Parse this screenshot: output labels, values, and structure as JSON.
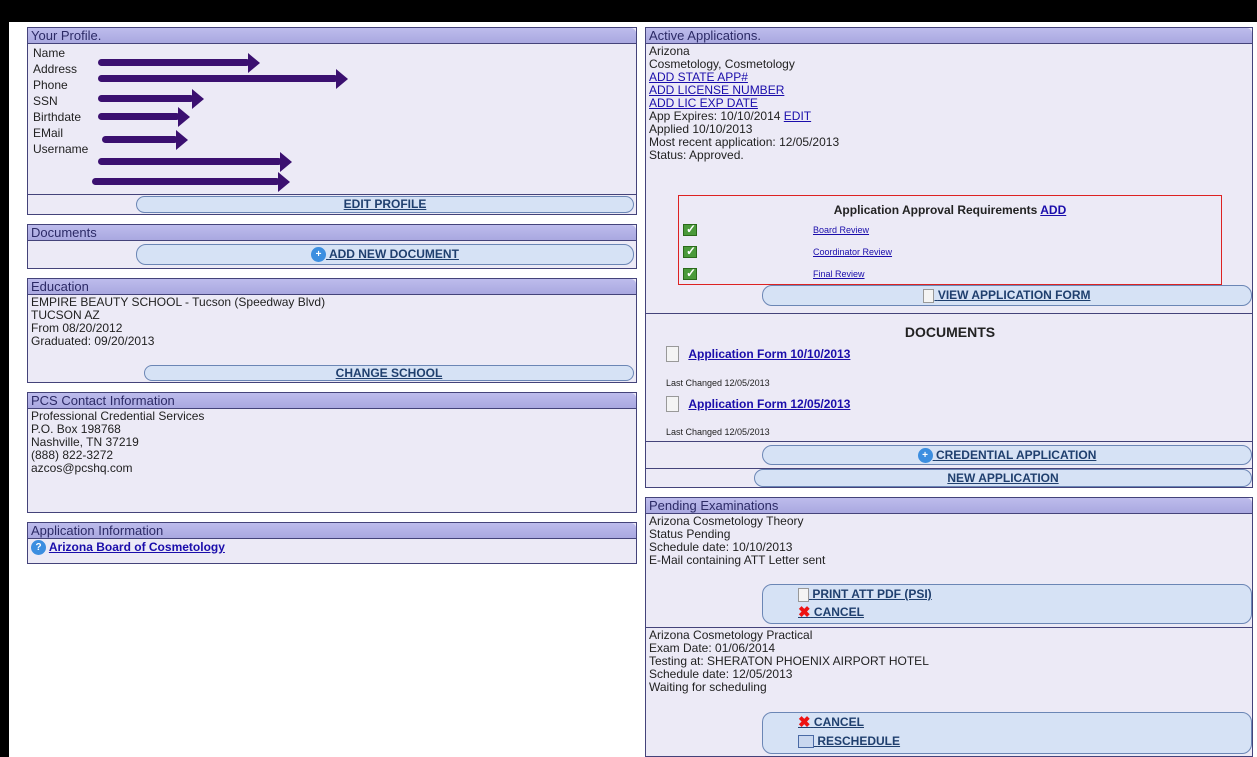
{
  "profile": {
    "title": "Your Profile.",
    "fields": [
      {
        "key": "Name"
      },
      {
        "key": "Address"
      },
      {
        "key": "Phone"
      },
      {
        "key": "SSN"
      },
      {
        "key": "Birthdate"
      },
      {
        "key": "EMail"
      },
      {
        "key": "Username"
      }
    ],
    "edit_label": "EDIT PROFILE"
  },
  "documents": {
    "title": "Documents",
    "add_label": "ADD NEW DOCUMENT"
  },
  "education": {
    "title": "Education",
    "school": "EMPIRE BEAUTY SCHOOL - Tucson (Speedway Blvd)",
    "city": "TUCSON AZ",
    "from": "From 08/20/2012",
    "graduated": "Graduated: 09/20/2013",
    "change_label": "CHANGE SCHOOL"
  },
  "contact": {
    "title": "PCS Contact Information",
    "lines": [
      "Professional Credential Services",
      "P.O. Box 198768",
      "Nashville, TN 37219",
      "(888) 822-3272",
      "azcos@pcshq.com"
    ]
  },
  "app_info": {
    "title": "Application Information",
    "link": "Arizona Board of Cosmetology"
  },
  "active": {
    "title": "Active Applications.",
    "state": "Arizona",
    "license": "Cosmetology, Cosmetology",
    "add_state_app": "ADD STATE APP#",
    "add_license": "ADD LICENSE NUMBER",
    "add_lic_exp": "ADD LIC EXP DATE",
    "expires": "App Expires: 10/10/2014",
    "edit": "EDIT",
    "applied": "Applied 10/10/2013",
    "recent": "Most recent application: 12/05/2013",
    "status": "Status: Approved.",
    "req_title": "Application Approval Requirements",
    "req_add": "ADD",
    "requirements": [
      "Board Review",
      "Coordinator Review",
      "Final Review"
    ],
    "view_form": "VIEW APPLICATION FORM",
    "docs_title": "DOCUMENTS",
    "docs": [
      {
        "name": "Application Form 10/10/2013",
        "changed": "Last Changed 12/05/2013"
      },
      {
        "name": "Application Form 12/05/2013",
        "changed": "Last Changed 12/05/2013"
      }
    ],
    "credential_app": "CREDENTIAL APPLICATION",
    "new_app": "NEW APPLICATION"
  },
  "pending": {
    "title": "Pending Examinations",
    "exam1": {
      "name": "Arizona Cosmetology Theory",
      "status": "Status Pending",
      "schedule": "Schedule date: 10/10/2013",
      "email": "E-Mail containing ATT Letter sent",
      "print": "PRINT ATT PDF (PSI)",
      "cancel": "CANCEL"
    },
    "exam2": {
      "name": "Arizona Cosmetology Practical",
      "exam_date": "Exam Date: 01/06/2014",
      "testing": "Testing at: SHERATON PHOENIX AIRPORT HOTEL",
      "schedule": "Schedule date: 12/05/2013",
      "waiting": "Waiting for scheduling",
      "cancel": "CANCEL",
      "reschedule": "RESCHEDULE"
    }
  }
}
